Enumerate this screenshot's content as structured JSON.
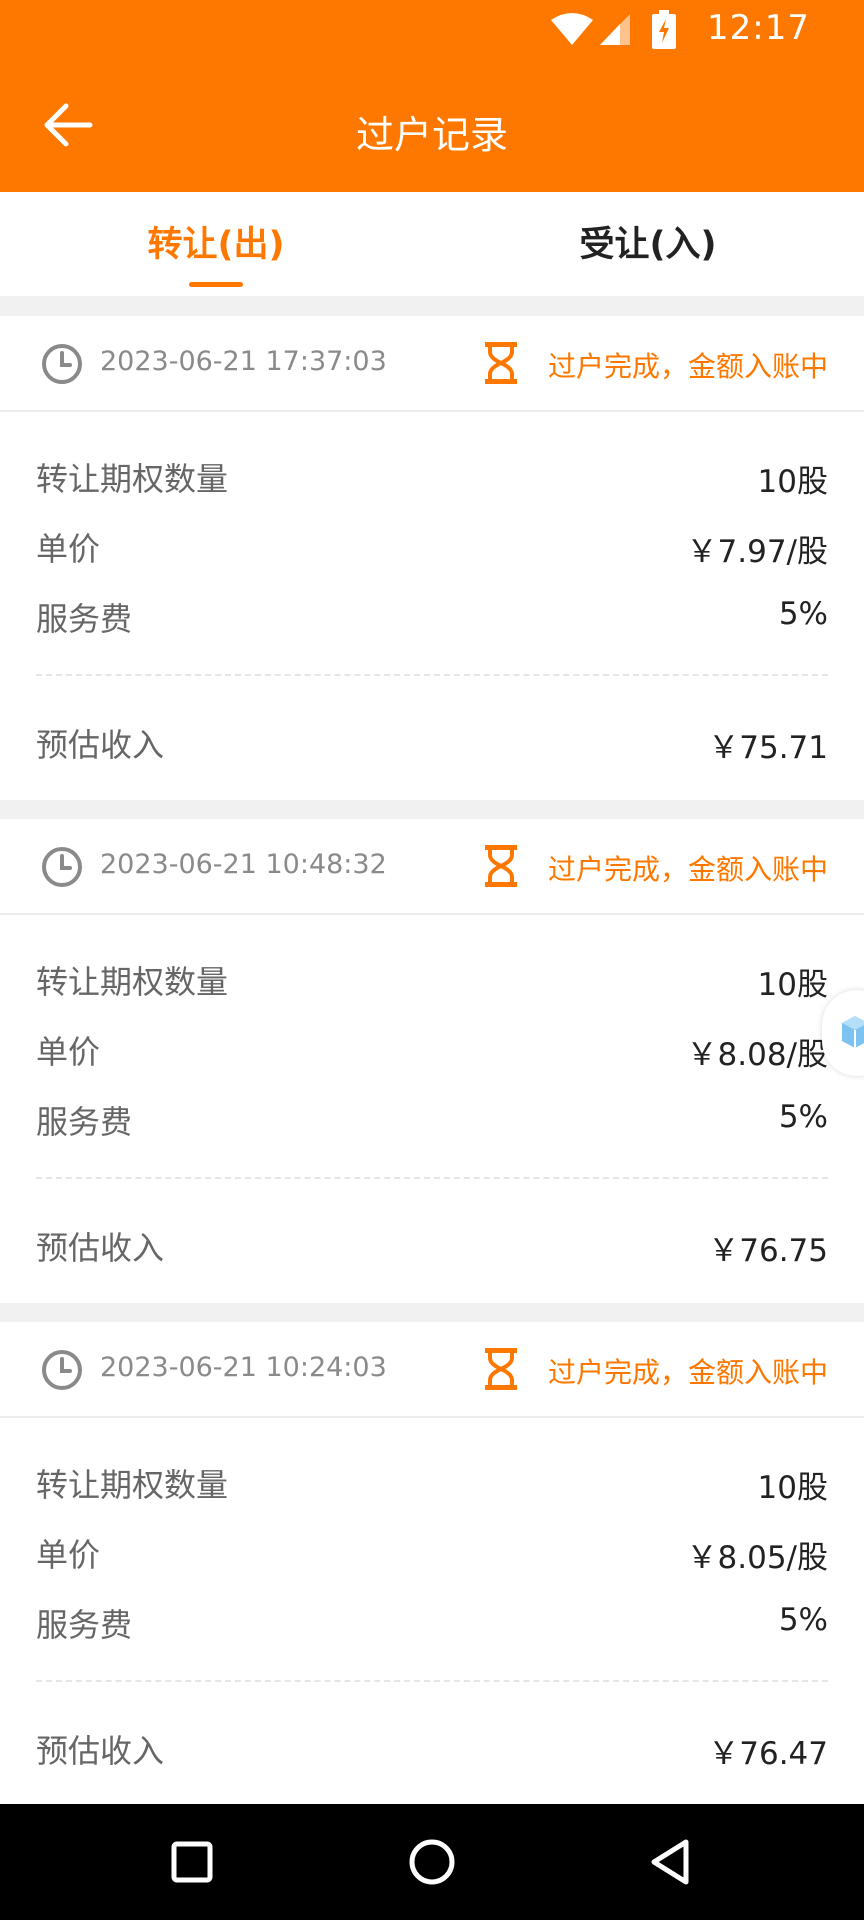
{
  "status_bar": {
    "time": "12:17"
  },
  "header": {
    "title": "过户记录"
  },
  "tabs": [
    {
      "label": "转让(出)",
      "active": true
    },
    {
      "label": "受让(入)",
      "active": false
    }
  ],
  "records": [
    {
      "time": "2023-06-21 17:37:03",
      "status": "过户完成，金额入账中",
      "quantity_label": "转让期权数量",
      "quantity": "10股",
      "price_label": "单价",
      "price": "￥7.97/股",
      "fee_label": "服务费",
      "fee": "5%",
      "income_label": "预估收入",
      "income": "￥75.71"
    },
    {
      "time": "2023-06-21 10:48:32",
      "status": "过户完成，金额入账中",
      "quantity_label": "转让期权数量",
      "quantity": "10股",
      "price_label": "单价",
      "price": "￥8.08/股",
      "fee_label": "服务费",
      "fee": "5%",
      "income_label": "预估收入",
      "income": "￥76.75"
    },
    {
      "time": "2023-06-21 10:24:03",
      "status": "过户完成，金额入账中",
      "quantity_label": "转让期权数量",
      "quantity": "10股",
      "price_label": "单价",
      "price": "￥8.05/股",
      "fee_label": "服务费",
      "fee": "5%",
      "income_label": "预估收入",
      "income": "￥76.47"
    }
  ],
  "colors": {
    "brand": "#fe7800",
    "text_primary": "#222222",
    "text_secondary": "#666666",
    "text_muted": "#8a8a8a"
  },
  "icons": [
    "back-arrow-icon",
    "clock-icon",
    "hourglass-icon",
    "wifi-icon",
    "signal-icon",
    "battery-icon",
    "cube-icon"
  ]
}
